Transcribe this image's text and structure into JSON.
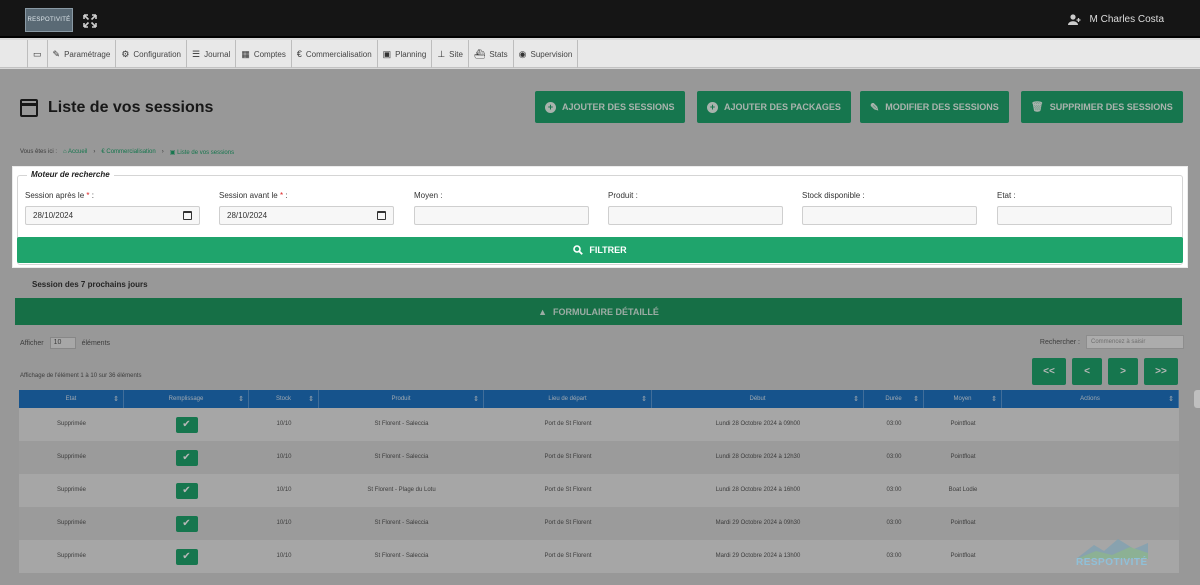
{
  "header": {
    "logo_text": "RESPOTIVITÉ",
    "user_name": "M Charles Costa"
  },
  "menu": [
    {
      "icon": "monitor-icon",
      "glyph": "▭",
      "label": ""
    },
    {
      "icon": "wrench-icon",
      "glyph": "✎",
      "label": "Paramétrage"
    },
    {
      "icon": "cogs-icon",
      "glyph": "⚙",
      "label": "Configuration"
    },
    {
      "icon": "list-icon",
      "glyph": "☰",
      "label": "Journal"
    },
    {
      "icon": "calculator-icon",
      "glyph": "▦",
      "label": "Comptes"
    },
    {
      "icon": "euro-icon",
      "glyph": "€",
      "label": "Commercialisation"
    },
    {
      "icon": "calendar-icon",
      "glyph": "▣",
      "label": "Planning"
    },
    {
      "icon": "sitemap-icon",
      "glyph": "⊥",
      "label": "Site"
    },
    {
      "icon": "ship-icon",
      "glyph": "⛴",
      "label": "Stats"
    },
    {
      "icon": "eye-icon",
      "glyph": "◉",
      "label": "Supervision"
    }
  ],
  "page": {
    "title": "Liste de vos sessions",
    "actions": [
      "AJOUTER DES SESSIONS",
      "AJOUTER DES PACKAGES",
      "MODIFIER DES SESSIONS",
      "SUPPRIMER DES SESSIONS"
    ],
    "breadcrumb": {
      "prefix": "Vous êtes ici :",
      "items": [
        "Accueil",
        "Commercialisation",
        "Liste de vos sessions"
      ]
    }
  },
  "search": {
    "legend": "Moteur de recherche",
    "fields": [
      {
        "label": "Session après le",
        "required": true,
        "value": "28/10/2024",
        "type": "date"
      },
      {
        "label": "Session avant le",
        "required": true,
        "value": "28/10/2024",
        "type": "date"
      },
      {
        "label": "Moyen :",
        "required": false,
        "value": "",
        "type": "text"
      },
      {
        "label": "Produit :",
        "required": false,
        "value": "",
        "type": "text"
      },
      {
        "label": "Stock disponible :",
        "required": false,
        "value": "",
        "type": "text"
      },
      {
        "label": "Etat :",
        "required": false,
        "value": "",
        "type": "text"
      }
    ],
    "filter_label": "FILTRER"
  },
  "list": {
    "subhead": "Session des 7 prochains jours",
    "big_button": "FORMULAIRE DÉTAILLÉ",
    "show_label": "Afficher",
    "show_value": "10",
    "show_suffix": "éléments",
    "search_label": "Rechercher :",
    "search_placeholder": "Commencez à saisir",
    "info": "Affichage de l'élément 1 à 10 sur 36 éléments",
    "pager": [
      "<<",
      "<",
      ">",
      ">>"
    ]
  },
  "table": {
    "columns": [
      "Etat",
      "Remplissage",
      "Stock",
      "Produit",
      "Lieu de départ",
      "Début",
      "Durée",
      "Moyen",
      "Actions"
    ],
    "rows": [
      {
        "etat": "Supprimée",
        "stock": "10/10",
        "produit": "St Florent - Saleccia",
        "lieu": "Port de St Florent",
        "debut": "Lundi 28 Octobre 2024 à 09h00",
        "duree": "03:00",
        "moyen": "Pointfloat"
      },
      {
        "etat": "Supprimée",
        "stock": "10/10",
        "produit": "St Florent - Saleccia",
        "lieu": "Port de St Florent",
        "debut": "Lundi 28 Octobre 2024 à 12h30",
        "duree": "03:00",
        "moyen": "Pointfloat"
      },
      {
        "etat": "Supprimée",
        "stock": "10/10",
        "produit": "St Florent - Plage du Lotu",
        "lieu": "Port de St Florent",
        "debut": "Lundi 28 Octobre 2024 à 16h00",
        "duree": "03:00",
        "moyen": "Boat Lodie"
      },
      {
        "etat": "Supprimée",
        "stock": "10/10",
        "produit": "St Florent - Saleccia",
        "lieu": "Port de St Florent",
        "debut": "Mardi 29 Octobre 2024 à 09h30",
        "duree": "03:00",
        "moyen": "Pointfloat"
      },
      {
        "etat": "Supprimée",
        "stock": "10/10",
        "produit": "St Florent - Saleccia",
        "lieu": "Port de St Florent",
        "debut": "Mardi 29 Octobre 2024 à 13h00",
        "duree": "03:00",
        "moyen": "Pointfloat"
      }
    ]
  },
  "watermark": "RESPOTIVITÉ",
  "colors": {
    "accent_green": "#1fa46c",
    "table_header_blue": "#1f74c2",
    "topbar": "#151515"
  }
}
